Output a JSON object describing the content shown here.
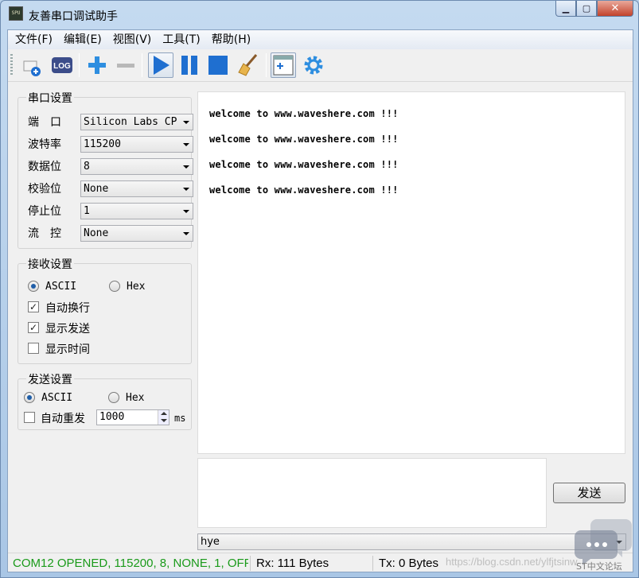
{
  "window": {
    "title": "友善串口调试助手",
    "app_icon_text": "SPU",
    "controls": [
      "minimize",
      "maximize",
      "close"
    ]
  },
  "menu": [
    "文件(F)",
    "编辑(E)",
    "视图(V)",
    "工具(T)",
    "帮助(H)"
  ],
  "toolbar": {
    "buttons": [
      "new-window",
      "log",
      "add",
      "remove",
      "start",
      "pause",
      "stop",
      "clear",
      "send-panel",
      "settings"
    ],
    "log_label": "LOG",
    "active": [
      "start",
      "send-panel"
    ]
  },
  "serial_settings": {
    "title": "串口设置",
    "port_label": "端　口",
    "port_value": "Silicon Labs CP",
    "baud_label": "波特率",
    "baud_value": "115200",
    "databits_label": "数据位",
    "databits_value": "8",
    "parity_label": "校验位",
    "parity_value": "None",
    "stopbits_label": "停止位",
    "stopbits_value": "1",
    "flow_label": "流　控",
    "flow_value": "None"
  },
  "receive_settings": {
    "title": "接收设置",
    "ascii_label": "ASCII",
    "hex_label": "Hex",
    "mode": "ASCII",
    "auto_wrap_label": "自动换行",
    "auto_wrap": true,
    "show_send_label": "显示发送",
    "show_send": true,
    "show_time_label": "显示时间",
    "show_time": false
  },
  "send_settings": {
    "title": "发送设置",
    "ascii_label": "ASCII",
    "hex_label": "Hex",
    "mode": "ASCII",
    "auto_resend_label": "自动重发",
    "auto_resend": false,
    "interval_value": "1000",
    "interval_unit": "ms"
  },
  "receive_lines": [
    "welcome to www.waveshere.com !!!",
    "welcome to www.waveshere.com !!!",
    "welcome to www.waveshere.com !!!",
    "welcome to www.waveshere.com !!!"
  ],
  "send_area_text": "",
  "send_button_label": "发送",
  "history_value": "hye",
  "status": {
    "connection": "COM12 OPENED, 115200, 8, NONE, 1, OFF",
    "connection_color": "#1a9a1a",
    "rx": "Rx: 111 Bytes",
    "tx": "Tx: 0 Bytes"
  },
  "watermark": {
    "url": "https://blog.csdn.net/ylfjtsinw",
    "brand": "ST中文论坛"
  }
}
